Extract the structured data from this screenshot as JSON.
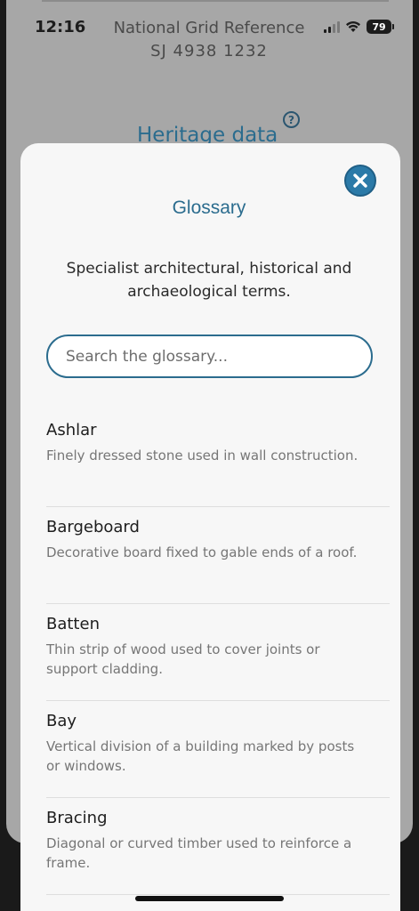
{
  "status_bar": {
    "time": "12:16",
    "battery": "79"
  },
  "background_page": {
    "grid_ref_label": "National Grid Reference",
    "grid_ref_value": "SJ 4938 1232",
    "heading": "Heritage data",
    "help_icon": "question-circle-icon",
    "help_glyph": "?"
  },
  "glossary": {
    "title": "Glossary",
    "description": "Specialist architectural, historical and archaeological terms.",
    "search_placeholder": "Search the glossary...",
    "close_icon": "close-icon",
    "terms": [
      {
        "name": "Ashlar",
        "definition": "Finely dressed stone used in wall construction."
      },
      {
        "name": "Bargeboard",
        "definition": "Decorative board fixed to gable ends of a roof."
      },
      {
        "name": "Batten",
        "definition": "Thin strip of wood used to cover joints or support cladding."
      },
      {
        "name": "Bay",
        "definition": "Vertical division of a building marked by posts or windows."
      },
      {
        "name": "Bracing",
        "definition": "Diagonal or curved timber used to reinforce a frame."
      }
    ]
  },
  "colors": {
    "accent": "#2b6c8e",
    "close_button": "#2b7aa8",
    "definition_text": "#767676"
  }
}
